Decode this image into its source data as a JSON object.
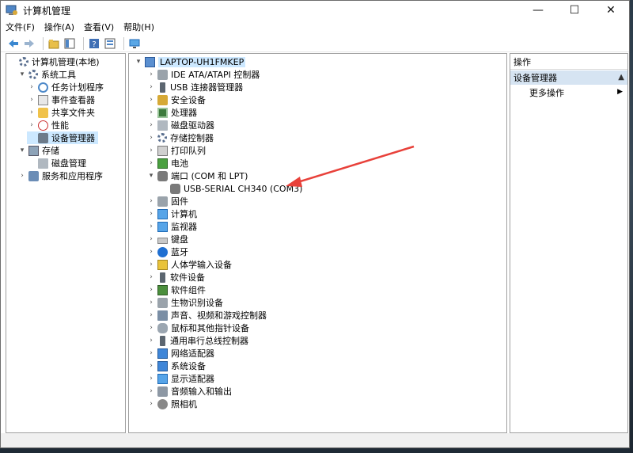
{
  "window": {
    "title": "计算机管理"
  },
  "window_controls": {
    "minimize": "—",
    "maximize": "☐",
    "close": "✕"
  },
  "menu": [
    "文件(F)",
    "操作(A)",
    "查看(V)",
    "帮助(H)"
  ],
  "left_tree": [
    {
      "label": "计算机管理(本地)",
      "indent": 0,
      "expander": "",
      "icon": "i-gear"
    },
    {
      "label": "系统工具",
      "indent": 1,
      "expander": "▾",
      "icon": "i-gear"
    },
    {
      "label": "任务计划程序",
      "indent": 2,
      "expander": "›",
      "icon": "i-clock"
    },
    {
      "label": "事件查看器",
      "indent": 2,
      "expander": "›",
      "icon": "i-doc"
    },
    {
      "label": "共享文件夹",
      "indent": 2,
      "expander": "›",
      "icon": "i-folder"
    },
    {
      "label": "性能",
      "indent": 2,
      "expander": "›",
      "icon": "i-perf"
    },
    {
      "label": "设备管理器",
      "indent": 2,
      "expander": "",
      "icon": "i-dev",
      "selected": true
    },
    {
      "label": "存储",
      "indent": 1,
      "expander": "▾",
      "icon": "i-store"
    },
    {
      "label": "磁盘管理",
      "indent": 2,
      "expander": "",
      "icon": "i-disk"
    },
    {
      "label": "服务和应用程序",
      "indent": 1,
      "expander": "›",
      "icon": "i-svc"
    }
  ],
  "device_tree": [
    {
      "label": "LAPTOP-UH1FMKEP",
      "indent": 0,
      "expander": "▾",
      "icon": "i-pc",
      "highlight": true
    },
    {
      "label": "IDE ATA/ATAPI 控制器",
      "indent": 1,
      "expander": "›",
      "icon": "i-gray"
    },
    {
      "label": "USB 连接器管理器",
      "indent": 1,
      "expander": "›",
      "icon": "i-usb"
    },
    {
      "label": "安全设备",
      "indent": 1,
      "expander": "›",
      "icon": "i-lock"
    },
    {
      "label": "处理器",
      "indent": 1,
      "expander": "›",
      "icon": "i-cpu"
    },
    {
      "label": "磁盘驱动器",
      "indent": 1,
      "expander": "›",
      "icon": "i-disk"
    },
    {
      "label": "存储控制器",
      "indent": 1,
      "expander": "›",
      "icon": "i-gear"
    },
    {
      "label": "打印队列",
      "indent": 1,
      "expander": "›",
      "icon": "i-print"
    },
    {
      "label": "电池",
      "indent": 1,
      "expander": "›",
      "icon": "i-bat"
    },
    {
      "label": "端口 (COM 和 LPT)",
      "indent": 1,
      "expander": "▾",
      "icon": "i-port"
    },
    {
      "label": "USB-SERIAL CH340 (COM3)",
      "indent": 2,
      "expander": "",
      "icon": "i-port"
    },
    {
      "label": "固件",
      "indent": 1,
      "expander": "›",
      "icon": "i-gray"
    },
    {
      "label": "计算机",
      "indent": 1,
      "expander": "›",
      "icon": "i-mon"
    },
    {
      "label": "监视器",
      "indent": 1,
      "expander": "›",
      "icon": "i-mon"
    },
    {
      "label": "键盘",
      "indent": 1,
      "expander": "›",
      "icon": "i-kbd"
    },
    {
      "label": "蓝牙",
      "indent": 1,
      "expander": "›",
      "icon": "i-bt"
    },
    {
      "label": "人体学输入设备",
      "indent": 1,
      "expander": "›",
      "icon": "i-yellow"
    },
    {
      "label": "软件设备",
      "indent": 1,
      "expander": "›",
      "icon": "i-usb"
    },
    {
      "label": "软件组件",
      "indent": 1,
      "expander": "›",
      "icon": "i-green"
    },
    {
      "label": "生物识别设备",
      "indent": 1,
      "expander": "›",
      "icon": "i-gray"
    },
    {
      "label": "声音、视频和游戏控制器",
      "indent": 1,
      "expander": "›",
      "icon": "i-sound"
    },
    {
      "label": "鼠标和其他指针设备",
      "indent": 1,
      "expander": "›",
      "icon": "i-mouse"
    },
    {
      "label": "通用串行总线控制器",
      "indent": 1,
      "expander": "›",
      "icon": "i-usb"
    },
    {
      "label": "网络适配器",
      "indent": 1,
      "expander": "›",
      "icon": "i-blue"
    },
    {
      "label": "系统设备",
      "indent": 1,
      "expander": "›",
      "icon": "i-blue"
    },
    {
      "label": "显示适配器",
      "indent": 1,
      "expander": "›",
      "icon": "i-mon"
    },
    {
      "label": "音频输入和输出",
      "indent": 1,
      "expander": "›",
      "icon": "i-audio"
    },
    {
      "label": "照相机",
      "indent": 1,
      "expander": "›",
      "icon": "i-camera"
    }
  ],
  "actions": {
    "header": "操作",
    "group": "设备管理器",
    "group_caret": "▲",
    "more": "更多操作",
    "more_arrow": "▶"
  },
  "colors": {
    "selection": "#cce8ff",
    "annotation_arrow": "#e8413a"
  }
}
